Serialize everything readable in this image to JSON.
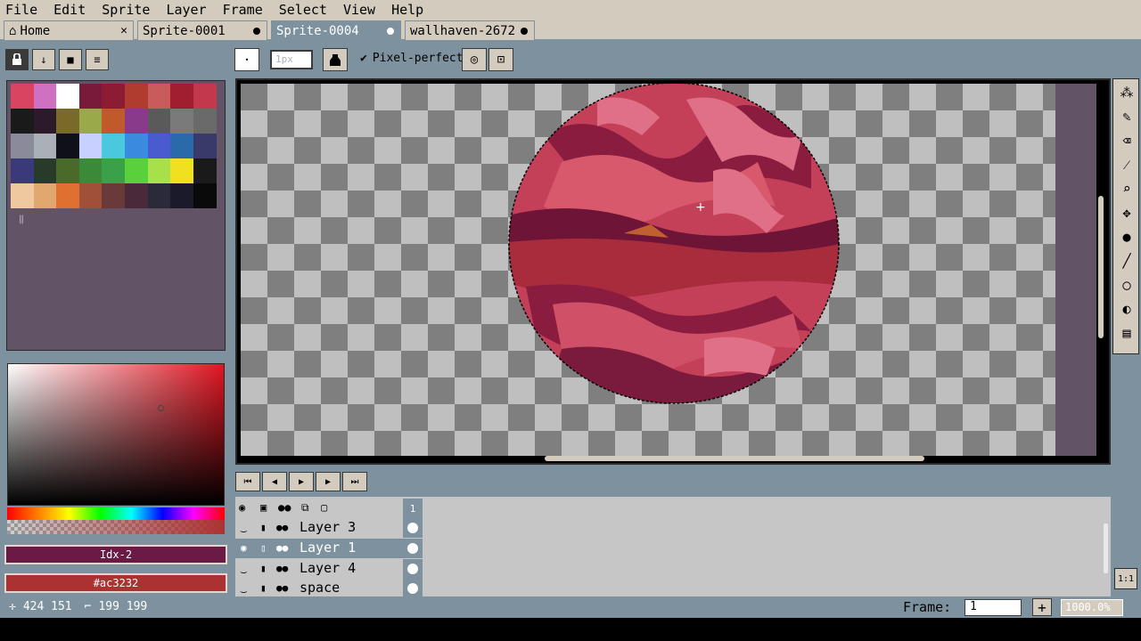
{
  "menu": [
    "File",
    "Edit",
    "Sprite",
    "Layer",
    "Frame",
    "Select",
    "View",
    "Help"
  ],
  "tabs": [
    {
      "label": "Home",
      "close": "✕"
    },
    {
      "label": "Sprite-0001"
    },
    {
      "label": "Sprite-0004"
    },
    {
      "label": "wallhaven-2672"
    }
  ],
  "palette_colors": [
    "#d94560",
    "#d070c0",
    "#ffffff",
    "#7a1a3a",
    "#8c1c34",
    "#b03c30",
    "#c85c5c",
    "#a01e30",
    "#c4384c",
    "#1a1a1a",
    "#2a1a2a",
    "#7a6a2a",
    "#9aaa4a",
    "#c05a2a",
    "#8a3a8a",
    "#5a5a5a",
    "#7a7a7a",
    "#6a6a6a",
    "#8a8a9a",
    "#aab0b8",
    "#101018",
    "#c8d0ff",
    "#4ac8e0",
    "#3a8ae0",
    "#4a5ad0",
    "#2a6aaa",
    "#3a3a6a",
    "#3a3a7a",
    "#2a3a2a",
    "#4a6a2a",
    "#3a8a3a",
    "#3aa04a",
    "#5ad03a",
    "#a8e04a",
    "#f0e020",
    "#1a1a1a",
    "#f0c8a0",
    "#e0a870",
    "#e07030",
    "#a05038",
    "#6a3a3a",
    "#4a2a3a",
    "#2a2a3a",
    "#1a1a2a",
    "#0a0a0a"
  ],
  "color_bars": {
    "fg": "Idx-2",
    "bg": "#ac3232",
    "fg_color": "#6a1a44",
    "bg_color": "#ac3232"
  },
  "tool_options": {
    "brush_size_placeholder": "1px",
    "pixel_perfect_label": "Pixel-perfect",
    "pixel_perfect_checked": "✔"
  },
  "timeline": {
    "frame_header": "1",
    "layers": [
      {
        "name": "Layer 3",
        "selected": false
      },
      {
        "name": "Layer 1",
        "selected": true
      },
      {
        "name": "Layer 4",
        "selected": false
      },
      {
        "name": "space",
        "selected": false
      }
    ]
  },
  "status": {
    "cursor_pos": "424 151",
    "sprite_size": "199 199",
    "frame_label": "Frame:",
    "frame_value": "1",
    "zoom_value": "1000.0%"
  }
}
